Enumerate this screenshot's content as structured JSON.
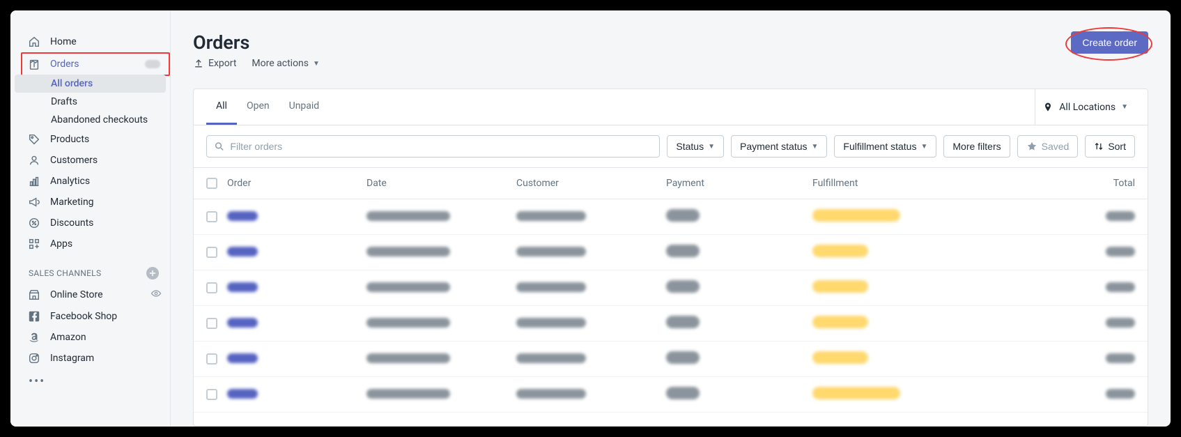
{
  "sidebar": {
    "home": "Home",
    "orders": "Orders",
    "all_orders": "All orders",
    "drafts": "Drafts",
    "abandoned": "Abandoned checkouts",
    "products": "Products",
    "customers": "Customers",
    "analytics": "Analytics",
    "marketing": "Marketing",
    "discounts": "Discounts",
    "apps": "Apps",
    "sales_channels": "SALES CHANNELS",
    "online_store": "Online Store",
    "facebook_shop": "Facebook Shop",
    "amazon": "Amazon",
    "instagram": "Instagram"
  },
  "page": {
    "title": "Orders",
    "create_order": "Create order",
    "export": "Export",
    "more_actions": "More actions"
  },
  "tabs": {
    "all": "All",
    "open": "Open",
    "unpaid": "Unpaid"
  },
  "locations": "All Locations",
  "filters": {
    "search_placeholder": "Filter orders",
    "status": "Status",
    "payment_status": "Payment status",
    "fulfillment_status": "Fulfillment status",
    "more_filters": "More filters",
    "saved": "Saved",
    "sort": "Sort"
  },
  "columns": {
    "order": "Order",
    "date": "Date",
    "customer": "Customer",
    "payment": "Payment",
    "fulfillment": "Fulfillment",
    "total": "Total"
  },
  "rows": [
    {
      "fulfill_width": 126
    },
    {
      "fulfill_width": 80
    },
    {
      "fulfill_width": 80
    },
    {
      "fulfill_width": 80
    },
    {
      "fulfill_width": 80
    },
    {
      "fulfill_width": 126
    }
  ]
}
